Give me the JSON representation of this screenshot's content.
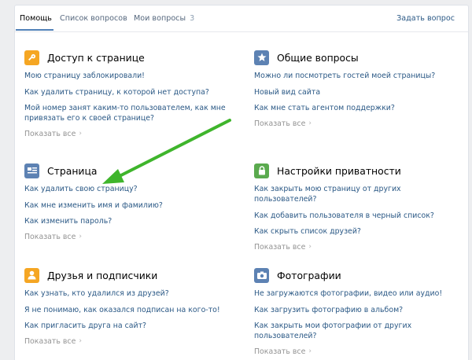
{
  "tabs": [
    {
      "label": "Помощь"
    },
    {
      "label": "Список вопросов"
    },
    {
      "label": "Мои вопросы",
      "count": "3"
    }
  ],
  "ask_label": "Задать вопрос",
  "more_label": "Показать все",
  "sections": [
    {
      "title": "Доступ к странице",
      "icon": "key-icon",
      "color": "#f5a623",
      "links": [
        "Мою страницу заблокировали!",
        "Как удалить страницу, к которой нет доступа?",
        "Мой номер занят каким-то пользователем, как мне привязать его к своей странице?"
      ]
    },
    {
      "title": "Общие вопросы",
      "icon": "star-icon",
      "color": "#5d82b3",
      "links": [
        "Можно ли посмотреть гостей моей страницы?",
        "Новый вид сайта",
        "Как мне стать агентом поддержки?"
      ]
    },
    {
      "title": "Страница",
      "icon": "profile-card-icon",
      "color": "#5d82b3",
      "links": [
        "Как удалить свою страницу?",
        "Как мне изменить имя и фамилию?",
        "Как изменить пароль?"
      ]
    },
    {
      "title": "Настройки приватности",
      "icon": "lock-icon",
      "color": "#5aaa4e",
      "links": [
        "Как закрыть мою страницу от других пользователей?",
        "Как добавить пользователя в черный список?",
        "Как скрыть список друзей?"
      ]
    },
    {
      "title": "Друзья и подписчики",
      "icon": "user-icon",
      "color": "#f5a623",
      "links": [
        "Как узнать, кто удалился из друзей?",
        "Я не понимаю, как оказался подписан на кого-то!",
        "Как пригласить друга на сайт?"
      ]
    },
    {
      "title": "Фотографии",
      "icon": "camera-icon",
      "color": "#5d82b3",
      "links": [
        "Не загружаются фотографии, видео или аудио!",
        "Как загрузить фотографию в альбом?",
        "Как закрыть мои фотографии от других пользователей?"
      ]
    }
  ]
}
